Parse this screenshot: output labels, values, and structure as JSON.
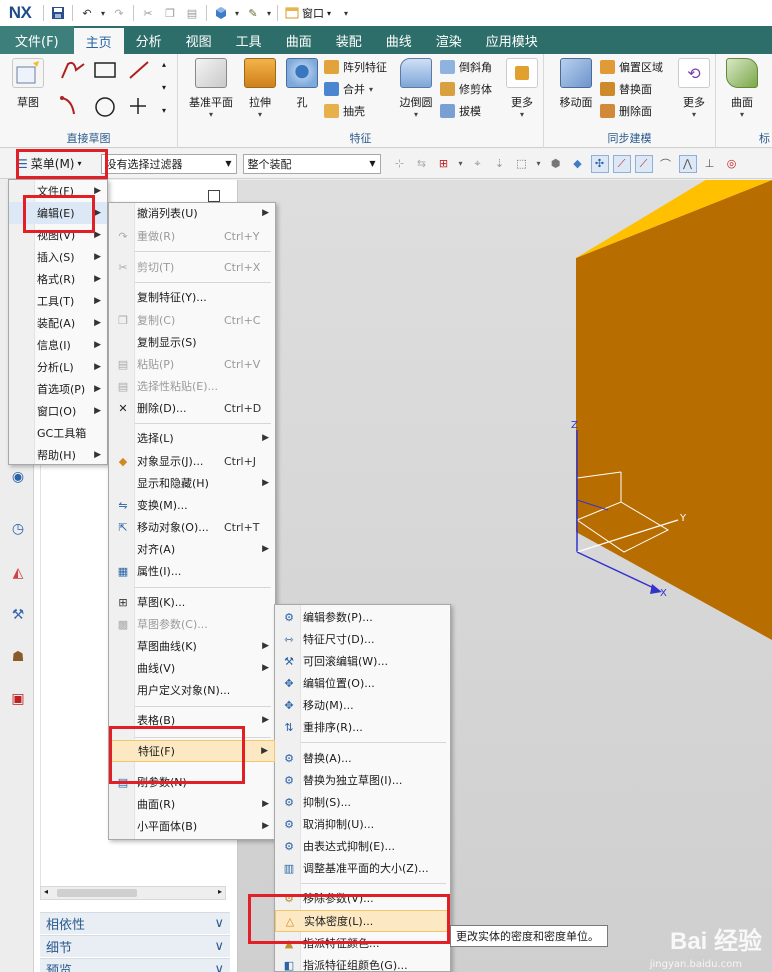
{
  "app": {
    "logo": "NX",
    "window_label": "窗口"
  },
  "tabs": {
    "file": "文件(F)",
    "home": "主页",
    "analysis": "分析",
    "view": "视图",
    "tools": "工具",
    "surface": "曲面",
    "assembly": "装配",
    "curve": "曲线",
    "render": "渲染",
    "app_module": "应用模块"
  },
  "ribbon": {
    "sketch": "草图",
    "direct_sketch_group": "直接草图",
    "datum_plane": "基准平面",
    "extrude": "拉伸",
    "hole": "孔",
    "pattern_feature": "阵列特征",
    "unite": "合并",
    "shell": "抽壳",
    "edge_blend": "边倒圆",
    "chamfer": "倒斜角",
    "trim_body": "修剪体",
    "draft": "拔模",
    "more": "更多",
    "feature_group": "特征",
    "move_face": "移动面",
    "offset_region": "偏置区域",
    "replace_face": "替换面",
    "delete_face": "删除面",
    "more2": "更多",
    "sync_group": "同步建模",
    "surface": "曲面",
    "cut_label": "标"
  },
  "selbar": {
    "menu": "菜单(M)",
    "filter": "没有选择过滤器",
    "scope": "整个装配"
  },
  "main_menu": [
    {
      "label": "文件(F)"
    },
    {
      "label": "编辑(E)"
    },
    {
      "label": "视图(V)"
    },
    {
      "label": "插入(S)"
    },
    {
      "label": "格式(R)"
    },
    {
      "label": "工具(T)"
    },
    {
      "label": "装配(A)"
    },
    {
      "label": "信息(I)"
    },
    {
      "label": "分析(L)"
    },
    {
      "label": "首选项(P)"
    },
    {
      "label": "窗口(O)"
    },
    {
      "label": "GC工具箱"
    },
    {
      "label": "帮助(H)"
    }
  ],
  "edit_menu": [
    {
      "label": "撤消列表(U)",
      "shortcut": ""
    },
    {
      "label": "重做(R)",
      "shortcut": "Ctrl+Y"
    },
    {
      "label": "剪切(T)",
      "shortcut": "Ctrl+X"
    },
    {
      "label": "复制特征(Y)...",
      "shortcut": ""
    },
    {
      "label": "复制(C)",
      "shortcut": "Ctrl+C"
    },
    {
      "label": "复制显示(S)",
      "shortcut": ""
    },
    {
      "label": "粘贴(P)",
      "shortcut": "Ctrl+V"
    },
    {
      "label": "选择性粘贴(E)...",
      "shortcut": ""
    },
    {
      "label": "删除(D)...",
      "shortcut": "Ctrl+D"
    },
    {
      "label": "选择(L)",
      "shortcut": ""
    },
    {
      "label": "对象显示(J)...",
      "shortcut": "Ctrl+J"
    },
    {
      "label": "显示和隐藏(H)",
      "shortcut": ""
    },
    {
      "label": "变换(M)...",
      "shortcut": ""
    },
    {
      "label": "移动对象(O)...",
      "shortcut": "Ctrl+T"
    },
    {
      "label": "对齐(A)",
      "shortcut": ""
    },
    {
      "label": "属性(I)...",
      "shortcut": ""
    },
    {
      "label": "草图(K)...",
      "shortcut": ""
    },
    {
      "label": "草图参数(C)...",
      "shortcut": ""
    },
    {
      "label": "草图曲线(K)",
      "shortcut": ""
    },
    {
      "label": "曲线(V)",
      "shortcut": ""
    },
    {
      "label": "用户定义对象(N)...",
      "shortcut": ""
    },
    {
      "label": "表格(B)",
      "shortcut": ""
    },
    {
      "label": "特征(F)",
      "shortcut": ""
    },
    {
      "label": "刚参数(N)",
      "shortcut": ""
    },
    {
      "label": "曲面(R)",
      "shortcut": ""
    },
    {
      "label": "小平面体(B)",
      "shortcut": ""
    }
  ],
  "feature_menu": [
    {
      "label": "编辑参数(P)..."
    },
    {
      "label": "特征尺寸(D)..."
    },
    {
      "label": "可回滚编辑(W)..."
    },
    {
      "label": "编辑位置(O)..."
    },
    {
      "label": "移动(M)..."
    },
    {
      "label": "重排序(R)..."
    },
    {
      "label": "替换(A)..."
    },
    {
      "label": "替换为独立草图(I)..."
    },
    {
      "label": "抑制(S)..."
    },
    {
      "label": "取消抑制(U)..."
    },
    {
      "label": "由表达式抑制(E)..."
    },
    {
      "label": "调整基准平面的大小(Z)..."
    },
    {
      "label": "移除参数(V)..."
    },
    {
      "label": "实体密度(L)..."
    },
    {
      "label": "指派特征颜色..."
    },
    {
      "label": "指派特征组颜色(G)..."
    }
  ],
  "tooltip": "更改实体的密度和密度单位。",
  "nav_sections": {
    "dependency": "相依性",
    "details": "细节",
    "preview": "预览"
  },
  "axes": {
    "x": "X",
    "y": "Y",
    "z": "Z"
  },
  "watermark": {
    "brand": "Bai 经验",
    "url": "jingyan.baidu.com"
  },
  "colors": {
    "ribbon_tab": "#2e6e6a",
    "solid_front": "#b86d00",
    "solid_top": "#ffc000",
    "highlight_box": "#e01f26"
  }
}
